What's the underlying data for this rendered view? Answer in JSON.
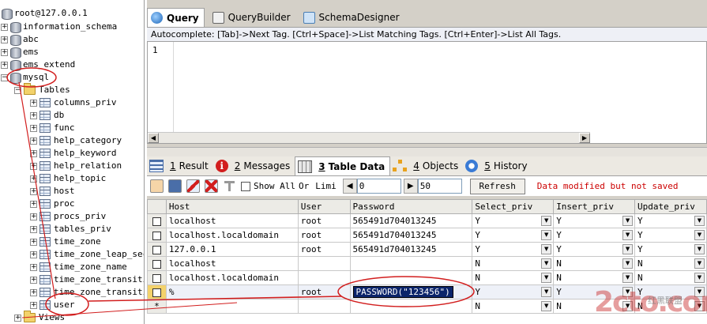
{
  "tree": {
    "root": "root@127.0.0.1",
    "databases": [
      "information_schema",
      "abc",
      "ems",
      "ems_extend",
      "mysql"
    ],
    "tables_folder": "Tables",
    "tables": [
      "columns_priv",
      "db",
      "func",
      "help_category",
      "help_keyword",
      "help_relation",
      "help_topic",
      "host",
      "proc",
      "procs_priv",
      "tables_priv",
      "time_zone",
      "time_zone_leap_sec",
      "time_zone_name",
      "time_zone_transiti",
      "time_zone_transiti",
      "user"
    ],
    "views_folder": "Views"
  },
  "editor_tabs": {
    "query": "Query",
    "query_builder": "QueryBuilder",
    "schema_designer": "SchemaDesigner"
  },
  "autocomplete": "Autocomplete: [Tab]->Next Tag. [Ctrl+Space]->List Matching Tags. [Ctrl+Enter]->List All Tags.",
  "editor": {
    "line_number": "1"
  },
  "result_tabs": [
    {
      "num": "1",
      "label": "Result"
    },
    {
      "num": "2",
      "label": "Messages"
    },
    {
      "num": "3",
      "label": "Table Data"
    },
    {
      "num": "4",
      "label": "Objects"
    },
    {
      "num": "5",
      "label": "History"
    }
  ],
  "toolbar": {
    "show_all": "Show All",
    "or": "Or",
    "limit": "Limi",
    "limit_start": "0",
    "limit_count": "50",
    "refresh": "Refresh",
    "status": "Data modified but not saved"
  },
  "grid": {
    "columns": [
      "Host",
      "User",
      "Password",
      "Select_priv",
      "Insert_priv",
      "Update_priv"
    ],
    "rows": [
      {
        "host": "localhost",
        "user": "root",
        "password": "565491d704013245",
        "select": "Y",
        "insert": "Y",
        "update": "Y"
      },
      {
        "host": "localhost.localdomain",
        "user": "root",
        "password": "565491d704013245",
        "select": "Y",
        "insert": "Y",
        "update": "Y"
      },
      {
        "host": "127.0.0.1",
        "user": "root",
        "password": "565491d704013245",
        "select": "Y",
        "insert": "Y",
        "update": "Y"
      },
      {
        "host": "localhost",
        "user": "",
        "password": "",
        "select": "N",
        "insert": "N",
        "update": "N"
      },
      {
        "host": "localhost.localdomain",
        "user": "",
        "password": "",
        "select": "N",
        "insert": "N",
        "update": "N"
      },
      {
        "host": "%",
        "user": "root",
        "password": "PASSWORD(\"123456\")",
        "select": "Y",
        "insert": "Y",
        "update": "Y"
      },
      {
        "host": "",
        "user": "",
        "password": "",
        "select": "N",
        "insert": "N",
        "update": "N"
      }
    ],
    "new_row_marker": "*"
  },
  "watermark": {
    "logo": "2cto.com",
    "sub": "红黑联盟"
  }
}
